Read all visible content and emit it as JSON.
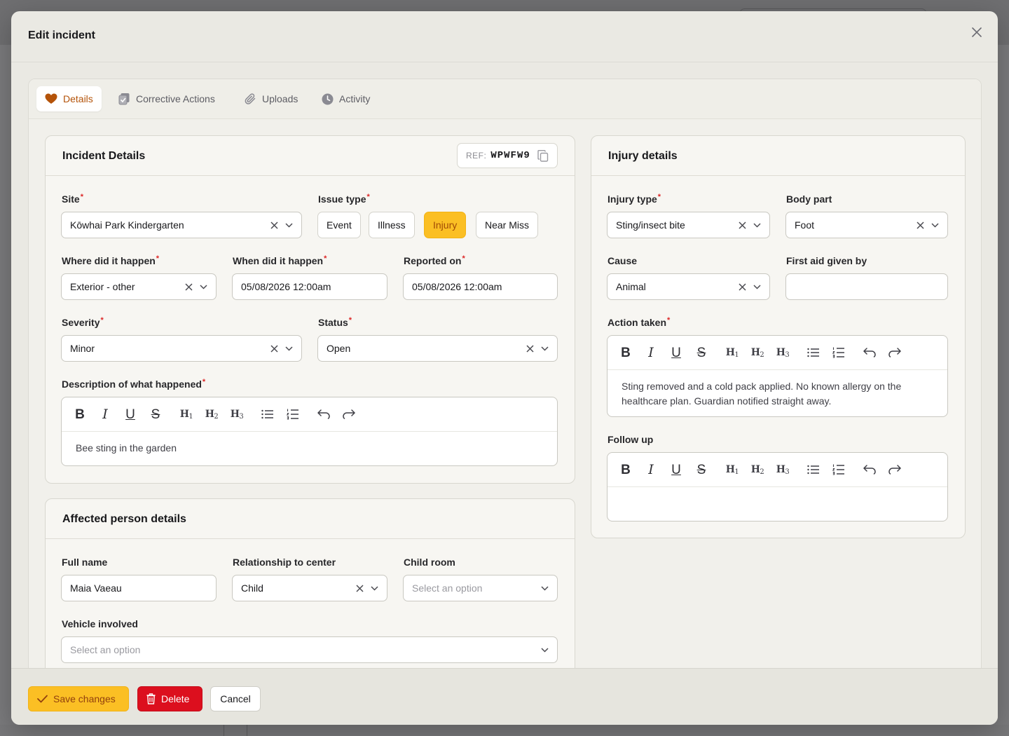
{
  "modal": {
    "title": "Edit incident",
    "tabs": [
      {
        "label": "Details",
        "icon": "heart-icon",
        "active": true
      },
      {
        "label": "Corrective Actions",
        "icon": "clipboard-check-icon"
      },
      {
        "label": "Uploads",
        "icon": "paperclip-icon"
      },
      {
        "label": "Activity",
        "icon": "clock-icon"
      }
    ]
  },
  "incident": {
    "title": "Incident Details",
    "ref_label": "REF:",
    "ref_code": "WPWFW9",
    "site_label": "Site",
    "site_value": "Kōwhai Park Kindergarten",
    "issue_type_label": "Issue type",
    "issue_types": [
      "Event",
      "Illness",
      "Injury",
      "Near Miss"
    ],
    "issue_type_selected": "Injury",
    "where_label": "Where did it happen",
    "where_value": "Exterior - other",
    "when_label": "When did it happen",
    "when_value": "05/08/2026 12:00am",
    "reported_label": "Reported on",
    "reported_value": "05/08/2026 12:00am",
    "severity_label": "Severity",
    "severity_value": "Minor",
    "status_label": "Status",
    "status_value": "Open",
    "description_label": "Description of what happened",
    "description_value": "Bee sting in the garden"
  },
  "affected": {
    "title": "Affected person details",
    "full_name_label": "Full name",
    "full_name_value": "Maia Vaeau",
    "relationship_label": "Relationship to center",
    "relationship_value": "Child",
    "child_room_label": "Child room",
    "child_room_placeholder": "Select an option",
    "vehicle_label": "Vehicle involved",
    "vehicle_placeholder": "Select an option"
  },
  "injury": {
    "title": "Injury details",
    "injury_type_label": "Injury type",
    "injury_type_value": "Sting/insect bite",
    "body_part_label": "Body part",
    "body_part_value": "Foot",
    "cause_label": "Cause",
    "cause_value": "Animal",
    "first_aid_label": "First aid given by",
    "first_aid_value": "",
    "action_label": "Action taken",
    "action_value": "Sting removed and a cold pack applied. No known allergy on the healthcare plan. Guardian notified straight away.",
    "follow_up_label": "Follow up",
    "follow_up_value": ""
  },
  "footer": {
    "save_label": "Save changes",
    "delete_label": "Delete",
    "cancel_label": "Cancel"
  },
  "colors": {
    "accent": "#fbbf24",
    "accent_text": "#b45309",
    "danger": "#dc0f1e",
    "required": "#dc2626"
  }
}
